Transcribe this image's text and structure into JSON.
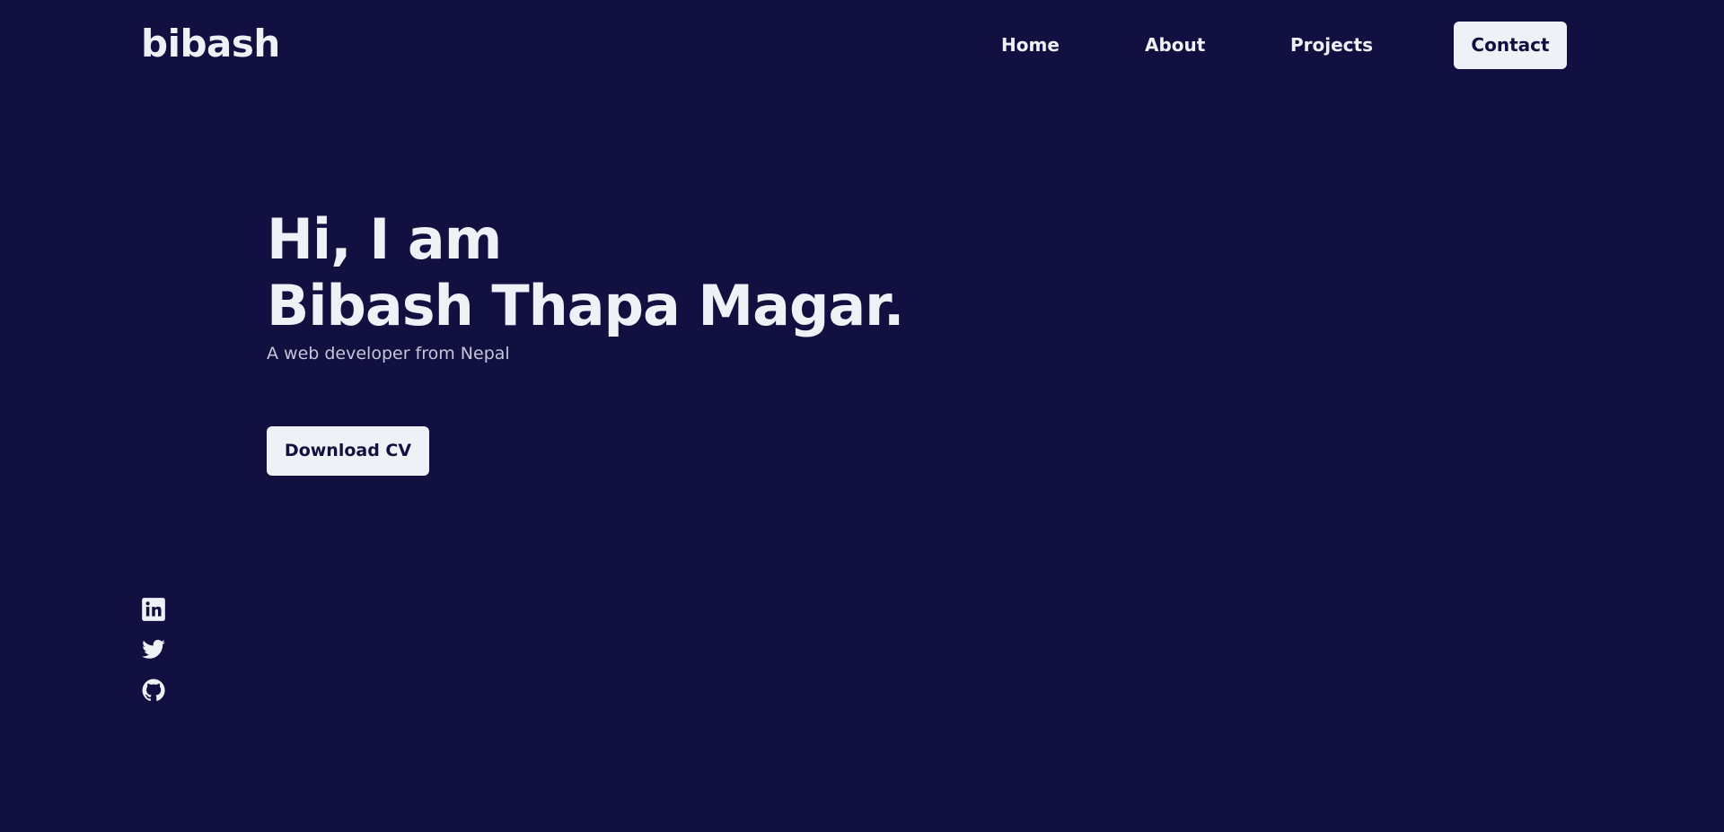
{
  "header": {
    "logo": "bibash",
    "nav": {
      "home": "Home",
      "about": "About",
      "projects": "Projects",
      "contact": "Contact"
    }
  },
  "hero": {
    "greeting": "Hi, I am",
    "name": "Bibash Thapa Magar.",
    "tagline": "A web developer from Nepal",
    "cta_label": "Download CV"
  },
  "social": {
    "icons": [
      "linkedin-icon",
      "twitter-icon",
      "github-icon"
    ]
  },
  "colors": {
    "background": "#120f41",
    "text": "#eef1f6",
    "button_bg": "#eef1f6",
    "button_text": "#120f41",
    "muted_text": "#c3c7d8"
  }
}
